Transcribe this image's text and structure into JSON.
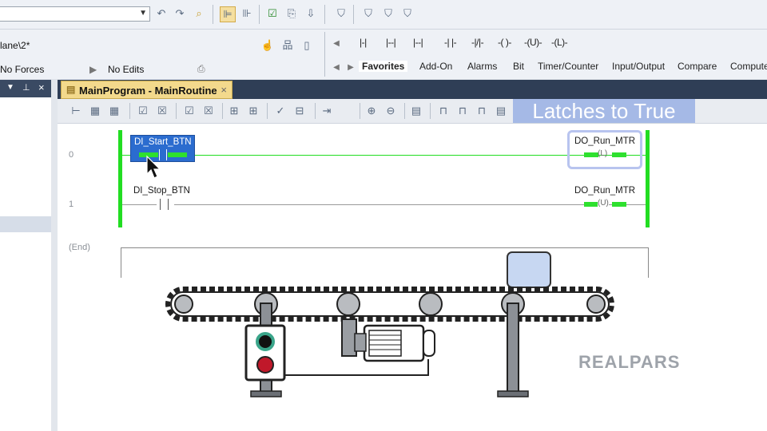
{
  "toolbar": {
    "path_combo_value": ""
  },
  "breadcrumb": "lane\\2*",
  "status": {
    "forces": "No Forces",
    "edits": "No Edits"
  },
  "instructions": [
    "|-|",
    "|--|",
    "|--|",
    "-| |-",
    "-|/|-",
    "-( )-",
    "-(U)-",
    "-(L)-"
  ],
  "instruction_tabs": [
    "Favorites",
    "Add-On",
    "Alarms",
    "Bit",
    "Timer/Counter",
    "Input/Output",
    "Compare",
    "Compute"
  ],
  "routine_tab": {
    "label": "MainProgram - MainRoutine",
    "close": "×"
  },
  "callout": "Latches to True",
  "rungs": [
    {
      "number": "0",
      "input_tag": "DI_Start_BTN",
      "output_tag": "DO_Run_MTR",
      "output_type": "L",
      "energized": true
    },
    {
      "number": "1",
      "input_tag": "DI_Stop_BTN",
      "output_tag": "DO_Run_MTR",
      "output_type": "U",
      "energized": false
    }
  ],
  "end_label": "(End)",
  "brand": "REALPARS",
  "colors": {
    "energized": "#2ee02e",
    "selection": "#2b6ccf",
    "callout": "#a5b9e6",
    "box": "#c7d7f2",
    "start_button": "#111111",
    "stop_button": "#c0182a"
  }
}
